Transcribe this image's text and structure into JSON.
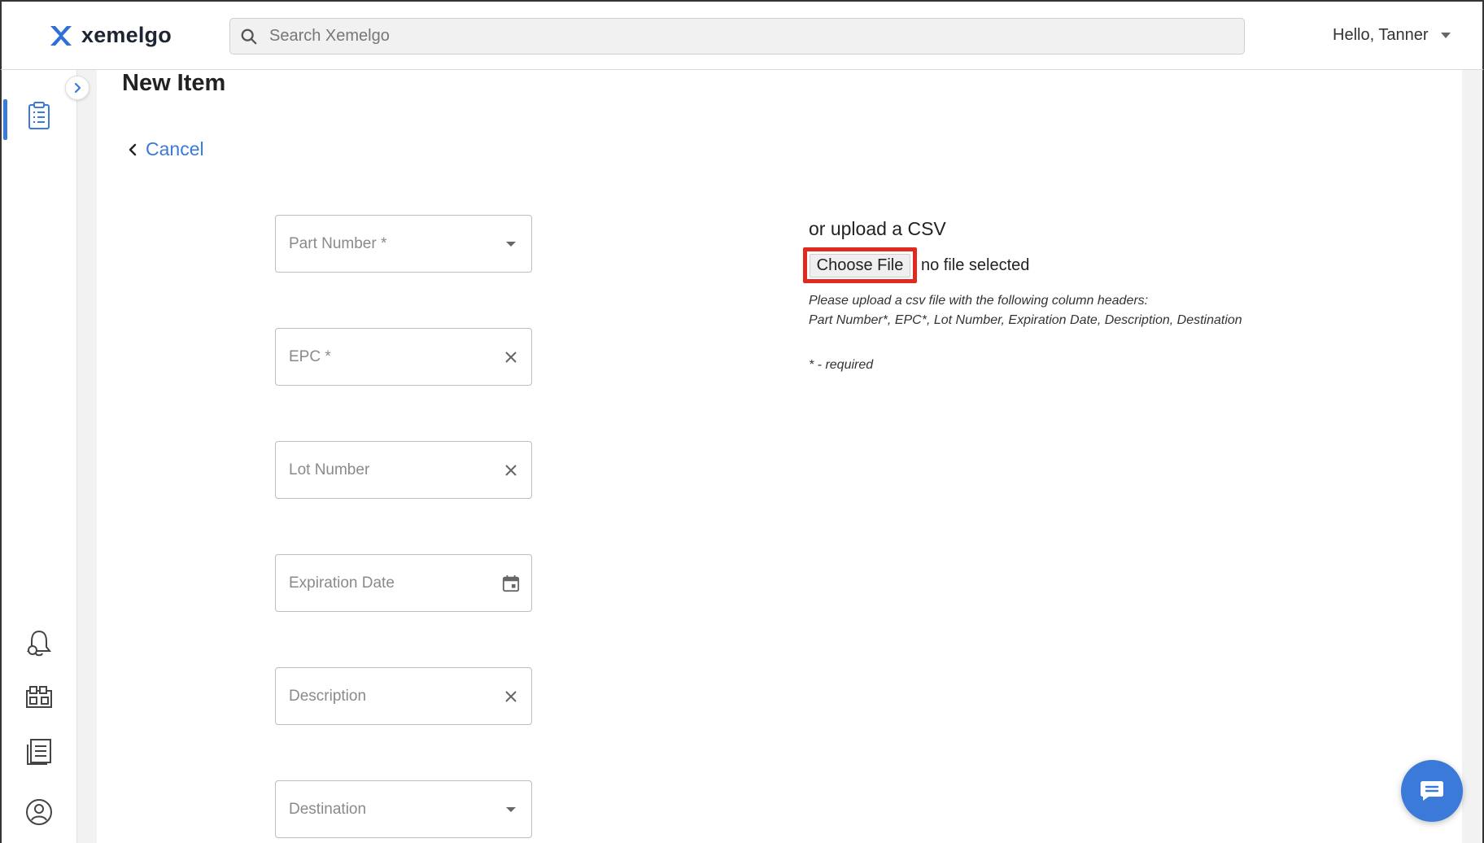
{
  "header": {
    "brand": "xemelgo",
    "search_placeholder": "Search Xemelgo",
    "user_greeting": "Hello, Tanner"
  },
  "sidebar": {
    "items": [
      {
        "icon": "clipboard-list-icon",
        "active": true
      },
      {
        "icon": "bell-alert-icon",
        "active": false
      },
      {
        "icon": "warehouse-icon",
        "active": false
      },
      {
        "icon": "report-list-icon",
        "active": false
      },
      {
        "icon": "user-account-icon",
        "active": false
      }
    ]
  },
  "page": {
    "title": "New Item",
    "cancel_label": "Cancel"
  },
  "form": {
    "fields": [
      {
        "label": "Part Number *",
        "type": "dropdown"
      },
      {
        "label": "EPC *",
        "type": "clearable"
      },
      {
        "label": "Lot Number",
        "type": "clearable"
      },
      {
        "label": "Expiration Date",
        "type": "date"
      },
      {
        "label": "Description",
        "type": "clearable"
      },
      {
        "label": "Destination",
        "type": "dropdown"
      }
    ]
  },
  "upload": {
    "title": "or upload a CSV",
    "choose_file_label": "Choose File",
    "no_file_text": "no file selected",
    "help_line1": "Please upload a csv file with the following column headers:",
    "help_line2": "Part Number*, EPC*, Lot Number, Expiration Date, Description, Destination",
    "required_note": "* - required"
  },
  "colors": {
    "accent": "#3b7ad8",
    "highlight": "#e02a20"
  }
}
